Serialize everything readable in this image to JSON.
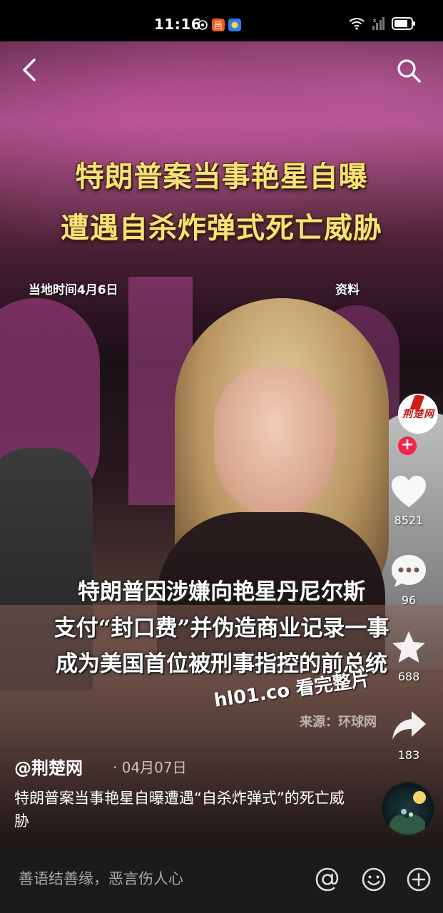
{
  "status_bar": {
    "time": "11:16",
    "icons_left": [
      "location-icon",
      "app-notification-icon",
      "app-badge-icon"
    ],
    "icons_right": [
      "wifi-icon",
      "signal-icon",
      "battery-icon"
    ]
  },
  "top_nav": {
    "back_icon": "chevron-left-icon",
    "search_icon": "search-icon"
  },
  "video": {
    "headline_line1": "特朗普案当事艳星自曝",
    "headline_line2": "遭遇自杀炸弹式死亡威胁",
    "overlay_date": "当地时间4月6日",
    "overlay_archive": "资料",
    "subtitle_line1": "特朗普因涉嫌向艳星丹尼尔斯",
    "subtitle_line2": "支付“封口费”并伪造商业记录一事",
    "subtitle_line3": "成为美国首位被刑事指控的前总统",
    "source": "来源：环球网",
    "watermark": "hl01.co 看完整片"
  },
  "sidebar": {
    "avatar_text": "荆楚网",
    "follow_label": "+",
    "like_count": "8521",
    "comment_count": "96",
    "favorite_count": "688",
    "share_count": "183"
  },
  "post": {
    "author": "@荆楚网",
    "date": "· 04月07日",
    "description": "特朗普案当事艳星自曝遭遇“自杀炸弹式”的死亡威胁"
  },
  "bottom_bar": {
    "comment_placeholder": "善语结善缘，恶言伤人心",
    "icons": [
      "at-icon",
      "emoji-icon",
      "plus-circle-icon"
    ]
  },
  "colors": {
    "headline": "#f7e277",
    "follow_button": "#f0264a",
    "bottom_bar_bg": "#1b1b1b"
  }
}
